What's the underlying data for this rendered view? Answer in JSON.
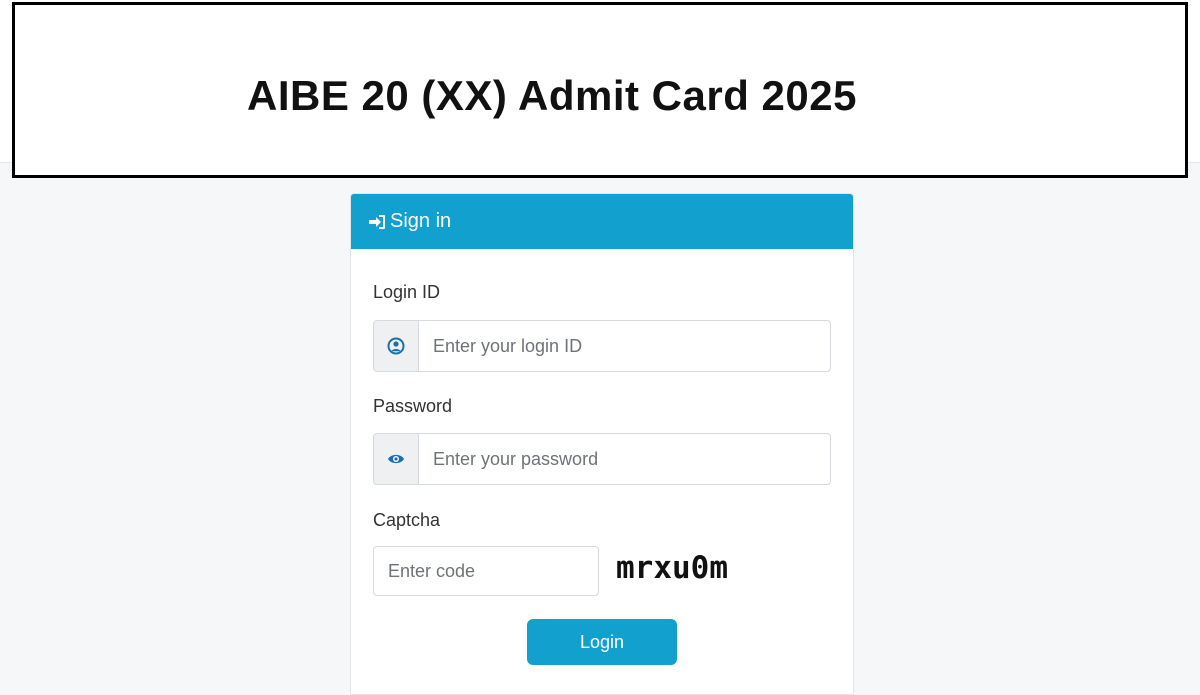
{
  "banner": {
    "title": "AIBE 20 (XX) Admit Card 2025"
  },
  "signin_card": {
    "header": "Sign in",
    "header_icon": "sign-in-icon",
    "accent_color": "#12a0cf",
    "login_id": {
      "label": "Login ID",
      "placeholder": "Enter your login ID",
      "icon": "user-circle-icon"
    },
    "password": {
      "label": "Password",
      "placeholder": "Enter your password",
      "icon": "eye-icon"
    },
    "captcha": {
      "label": "Captcha",
      "placeholder": "Enter code",
      "code": "mrxu0m"
    },
    "login_button": "Login"
  }
}
